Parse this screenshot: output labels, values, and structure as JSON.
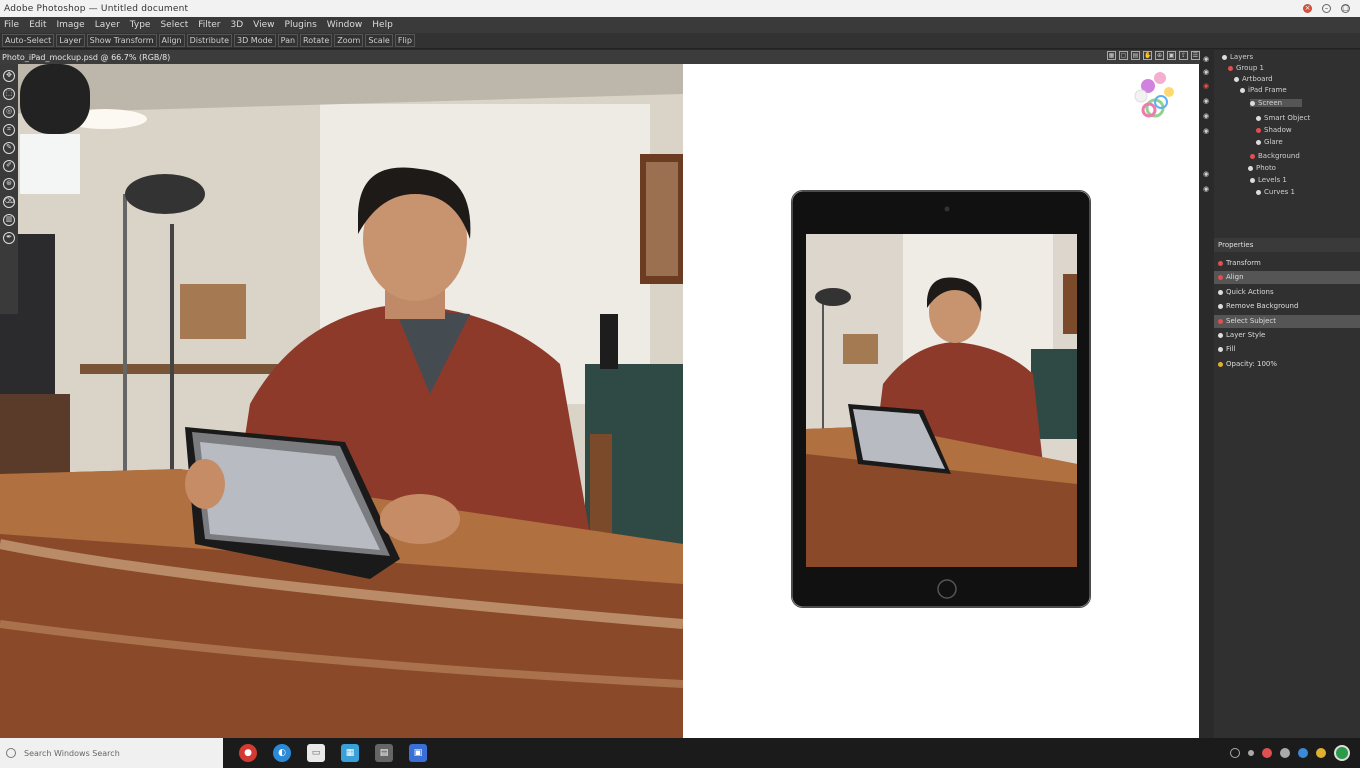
{
  "window": {
    "title": "Adobe Photoshop — Untitled document"
  },
  "menubar": {
    "items": [
      "File",
      "Edit",
      "Image",
      "Layer",
      "Type",
      "Select",
      "Filter",
      "3D",
      "View",
      "Plugins",
      "Window",
      "Help"
    ]
  },
  "options": {
    "items": [
      "Auto-Select",
      "Layer",
      "Show Transform",
      "Align",
      "Distribute",
      "3D Mode",
      "Pan",
      "Rotate",
      "Zoom",
      "Scale",
      "Flip"
    ]
  },
  "document": {
    "tab_label": "Photo_iPad_mockup.psd @ 66.7% (RGB/8)"
  },
  "toolbar": {
    "tools": [
      "move-tool",
      "marquee-tool",
      "lasso-tool",
      "crop-tool",
      "eyedropper-tool",
      "brush-tool",
      "stamp-tool",
      "eraser-tool",
      "gradient-tool",
      "pen-tool"
    ]
  },
  "layers_tree": [
    {
      "label": "Layers",
      "depth": 0
    },
    {
      "label": "Group 1",
      "depth": 1
    },
    {
      "label": "Artboard",
      "depth": 2
    },
    {
      "label": "iPad Frame",
      "depth": 3
    },
    {
      "label": "Screen",
      "depth": 4
    },
    {
      "label": "Smart Object",
      "depth": 4
    },
    {
      "label": "Shadow",
      "depth": 4
    },
    {
      "label": "Glare",
      "depth": 4
    },
    {
      "label": "Background",
      "depth": 3
    },
    {
      "label": "Photo",
      "depth": 2
    },
    {
      "label": "Levels 1",
      "depth": 2
    },
    {
      "label": "Curves 1",
      "depth": 2
    }
  ],
  "properties": {
    "title": "Properties",
    "rows": [
      {
        "label": "Transform",
        "selected": false
      },
      {
        "label": "Align",
        "selected": true
      },
      {
        "label": "Quick Actions",
        "selected": false
      },
      {
        "label": "Remove Background",
        "selected": false
      },
      {
        "label": "Select Subject",
        "selected": true
      },
      {
        "label": "Layer Style",
        "selected": false
      },
      {
        "label": "Fill",
        "selected": false
      },
      {
        "label": "Opacity: 100%",
        "selected": false
      }
    ]
  },
  "taskbar": {
    "search_placeholder": "Search Windows Search",
    "apps": [
      "photoshop",
      "browser",
      "files",
      "store",
      "mail",
      "settings"
    ]
  },
  "colors": {
    "titlebar": "#f2f2f2",
    "menubar": "#3a3a3a",
    "panel": "#303030",
    "accent": "#e04a3f",
    "taskbar": "#1b1b1b"
  }
}
